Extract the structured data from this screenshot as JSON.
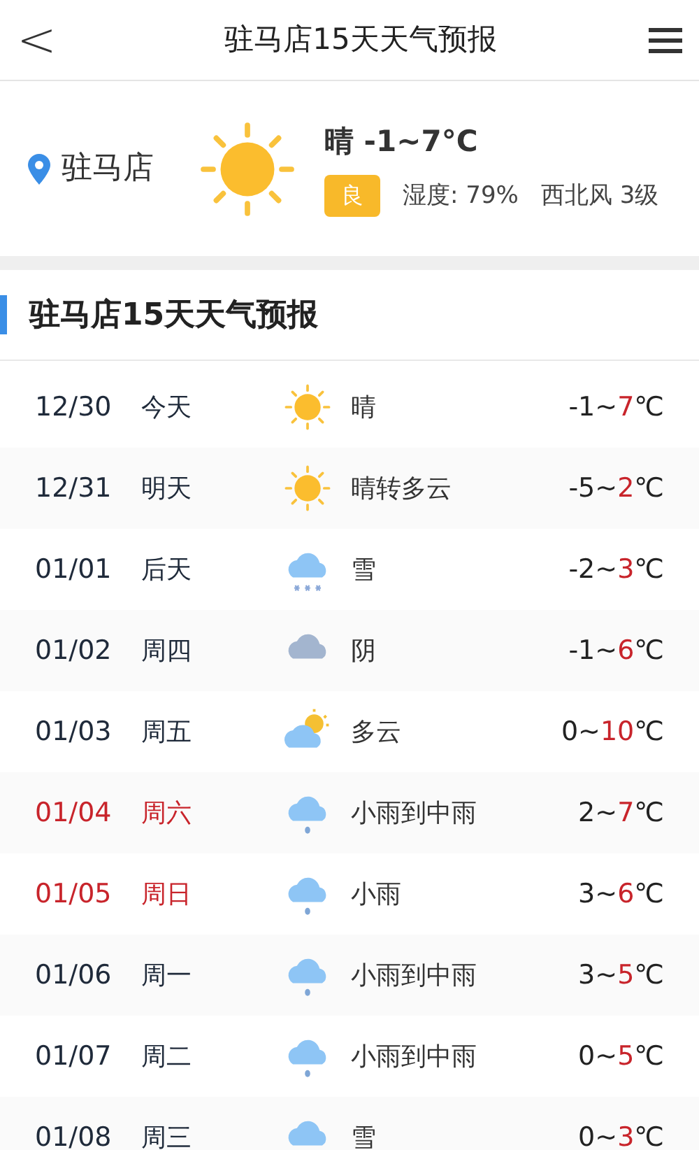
{
  "header": {
    "back": "<",
    "title": "驻马店15天天气预报"
  },
  "current": {
    "city": "驻马店",
    "kind": "sunny",
    "summary": "晴 -1~7°C",
    "aqi": "良",
    "humidity": "湿度: 79%",
    "wind": "西北风 3级"
  },
  "section_title": "驻马店15天天气预报",
  "days": [
    {
      "date": "12/30",
      "day": "今天",
      "weekend": false,
      "kind": "sunny",
      "weather": "晴",
      "low": "-1",
      "sep": "~",
      "high": "7",
      "unit": "℃"
    },
    {
      "date": "12/31",
      "day": "明天",
      "weekend": false,
      "kind": "sunny",
      "weather": "晴转多云",
      "low": "-5",
      "sep": "~",
      "high": "2",
      "unit": "℃"
    },
    {
      "date": "01/01",
      "day": "后天",
      "weekend": false,
      "kind": "snow",
      "weather": "雪",
      "low": "-2",
      "sep": "~",
      "high": "3",
      "unit": "℃"
    },
    {
      "date": "01/02",
      "day": "周四",
      "weekend": false,
      "kind": "overcast",
      "weather": "阴",
      "low": "-1",
      "sep": "~",
      "high": "6",
      "unit": "℃"
    },
    {
      "date": "01/03",
      "day": "周五",
      "weekend": false,
      "kind": "partly_cloudy",
      "weather": "多云",
      "low": "0",
      "sep": "~",
      "high": "10",
      "unit": "℃"
    },
    {
      "date": "01/04",
      "day": "周六",
      "weekend": true,
      "kind": "rain",
      "weather": "小雨到中雨",
      "low": "2",
      "sep": "~",
      "high": "7",
      "unit": "℃"
    },
    {
      "date": "01/05",
      "day": "周日",
      "weekend": true,
      "kind": "rain",
      "weather": "小雨",
      "low": "3",
      "sep": "~",
      "high": "6",
      "unit": "℃"
    },
    {
      "date": "01/06",
      "day": "周一",
      "weekend": false,
      "kind": "rain",
      "weather": "小雨到中雨",
      "low": "3",
      "sep": "~",
      "high": "5",
      "unit": "℃"
    },
    {
      "date": "01/07",
      "day": "周二",
      "weekend": false,
      "kind": "rain",
      "weather": "小雨到中雨",
      "low": "0",
      "sep": "~",
      "high": "5",
      "unit": "℃"
    },
    {
      "date": "01/08",
      "day": "周三",
      "weekend": false,
      "kind": "snow",
      "weather": "雪",
      "low": "0",
      "sep": "~",
      "high": "3",
      "unit": "℃"
    }
  ]
}
